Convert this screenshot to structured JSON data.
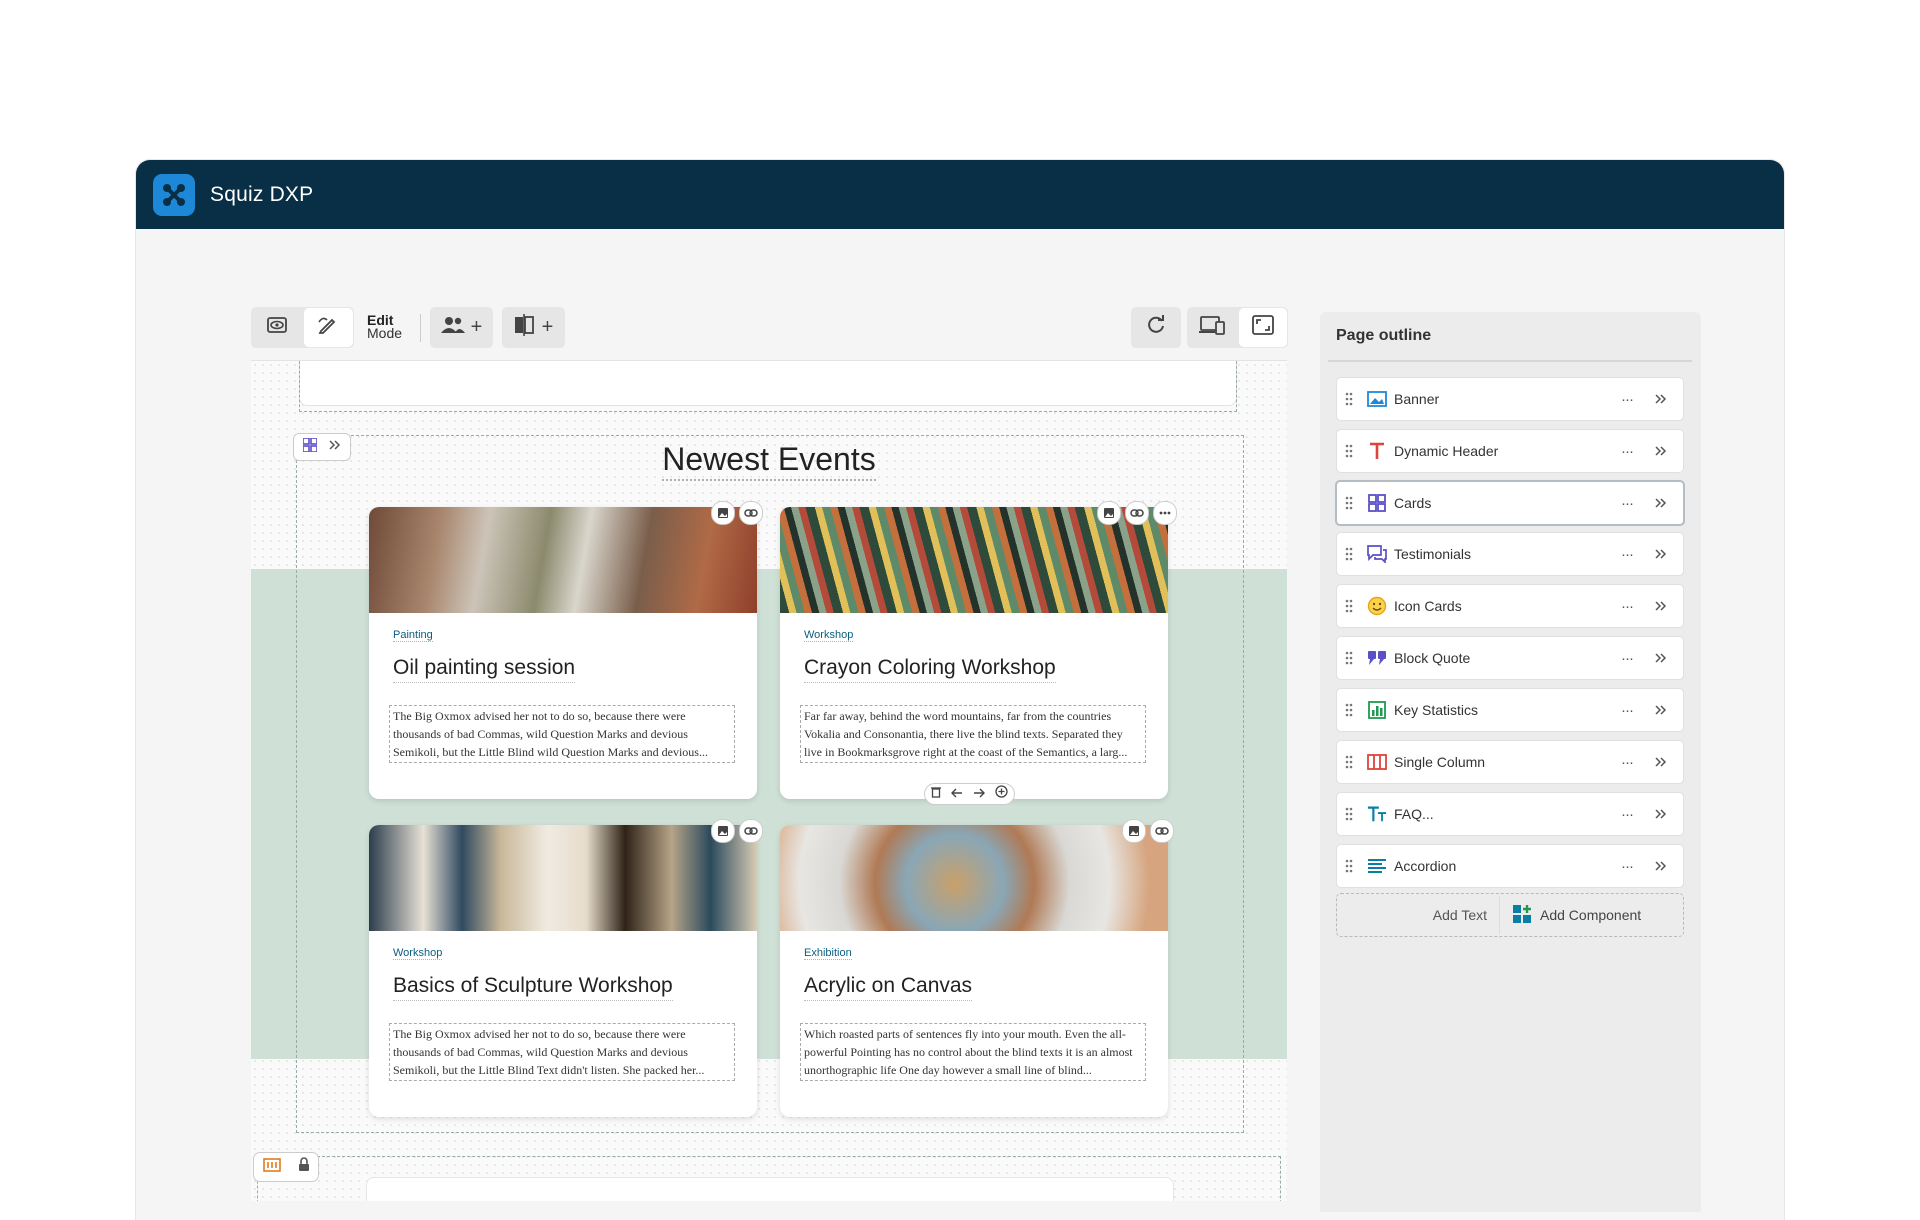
{
  "app": {
    "title": "Squiz DXP"
  },
  "toolbar": {
    "edit_title": "Edit",
    "edit_sub": "Mode"
  },
  "section": {
    "title": "Newest Events",
    "cards": [
      {
        "category": "Painting",
        "title": "Oil painting session",
        "description": "The Big Oxmox advised her not to do so, because there were thousands of bad Commas, wild Question Marks and devious Semikoli, but the Little Blind wild Question Marks and devious..."
      },
      {
        "category": "Workshop",
        "title": "Crayon Coloring Workshop",
        "description": "Far far away, behind the word mountains, far from the countries Vokalia and Consonantia, there live the blind texts. Separated they live in Bookmarksgrove right at the coast of the Semantics, a larg..."
      },
      {
        "category": "Workshop",
        "title": "Basics of Sculpture Workshop",
        "description": "The Big Oxmox advised her not to do so, because there were thousands of bad Commas, wild Question Marks and devious Semikoli, but the Little Blind Text didn't listen. She packed her..."
      },
      {
        "category": "Exhibition",
        "title": "Acrylic on Canvas",
        "description": "Which roasted parts of sentences fly into your mouth. Even the all-powerful Pointing has no control about the blind texts it is an almost unorthographic life One day however a small line of blind..."
      }
    ]
  },
  "outline": {
    "title": "Page outline",
    "items": [
      {
        "label": "Banner",
        "icon": "banner-icon",
        "color": "#1e88d8"
      },
      {
        "label": "Dynamic Header",
        "icon": "text-t-icon",
        "color": "#e0433a"
      },
      {
        "label": "Cards",
        "icon": "cards-grid-icon",
        "color": "#5b4fc7",
        "selected": true
      },
      {
        "label": "Testimonials",
        "icon": "chat-bubbles-icon",
        "color": "#5b4fc7"
      },
      {
        "label": "Icon Cards",
        "icon": "smiley-icon",
        "color": "#f2b41e"
      },
      {
        "label": "Block Quote",
        "icon": "quote-icon",
        "color": "#5b4fc7"
      },
      {
        "label": "Key Statistics",
        "icon": "bar-chart-icon",
        "color": "#1e9a4f"
      },
      {
        "label": "Single Column",
        "icon": "columns-icon",
        "color": "#e0433a"
      },
      {
        "label": "FAQ...",
        "icon": "text-tt-icon",
        "color": "#0a7ea4"
      },
      {
        "label": "Accordion",
        "icon": "list-lines-icon",
        "color": "#0a7ea4"
      }
    ],
    "more_label": "···",
    "add_text": "Add Text",
    "add_component": "Add Component"
  },
  "colors": {
    "titlebar": "#082f45",
    "band": "#cfe0d6",
    "accent": "#1e88d8"
  }
}
